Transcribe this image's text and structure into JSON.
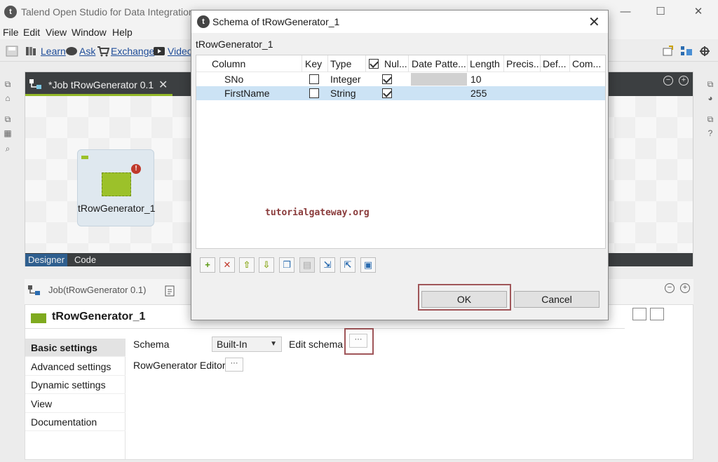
{
  "window": {
    "title": "Talend Open Studio for Data Integration",
    "controls": {
      "minimize": "—",
      "maximize": "☐",
      "close": "✕"
    }
  },
  "menu": [
    "File",
    "Edit",
    "View",
    "Window",
    "Help"
  ],
  "toolbar": {
    "learn": "Learn",
    "ask": "Ask",
    "exchange": "Exchange",
    "video": "Videos"
  },
  "job_tab": {
    "label": "*Job tRowGenerator 0.1",
    "close": "✕"
  },
  "component": {
    "label": "tRowGenerator_1",
    "error": "!"
  },
  "designer_tabs": [
    "Designer",
    "Code"
  ],
  "component_view": {
    "tab": "Job(tRowGenerator 0.1)",
    "header": "tRowGenerator_1",
    "nav": [
      "Basic settings",
      "Advanced settings",
      "Dynamic settings",
      "View",
      "Documentation"
    ],
    "schema_label": "Schema",
    "schema_value": "Built-In",
    "edit_schema_label": "Edit schema",
    "row_editor_label": "RowGenerator Editor",
    "dots": "···"
  },
  "dialog": {
    "title": "Schema of tRowGenerator_1",
    "subtitle": "tRowGenerator_1",
    "close": "✕",
    "columns": [
      "Column",
      "Key",
      "Type",
      "Nul...",
      "Date Patte...",
      "Length",
      "Precis...",
      "Def...",
      "Com..."
    ],
    "rows": [
      {
        "column": "SNo",
        "key": false,
        "type": "Integer",
        "nullable": true,
        "date_pattern": "",
        "length": "10",
        "selected": false
      },
      {
        "column": "FirstName",
        "key": false,
        "type": "String",
        "nullable": true,
        "date_pattern": "",
        "length": "255",
        "selected": true
      }
    ],
    "watermark": "tutorialgateway.org",
    "tools": [
      "plus-icon",
      "delete-icon",
      "move-up-icon",
      "move-down-icon",
      "copy-icon",
      "paste-icon",
      "import-icon",
      "export-icon",
      "save-icon"
    ],
    "ok": "OK",
    "cancel": "Cancel"
  }
}
